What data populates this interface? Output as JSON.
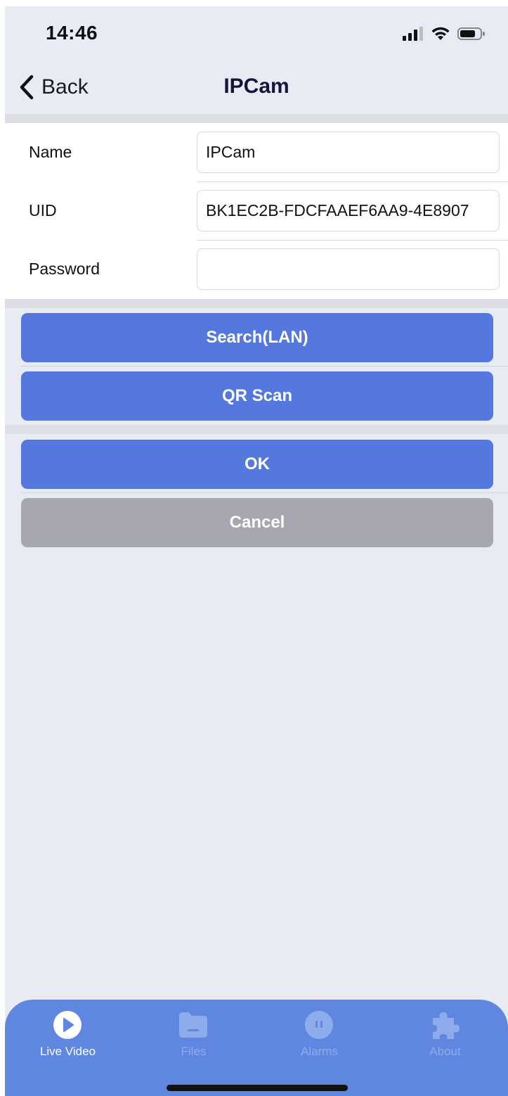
{
  "status_bar": {
    "time": "14:46"
  },
  "nav": {
    "back_label": "Back",
    "title": "IPCam"
  },
  "form": {
    "name_label": "Name",
    "name_value": "IPCam",
    "uid_label": "UID",
    "uid_value": "BK1EC2B-FDCFAAEF6AA9-4E8907",
    "password_label": "Password",
    "password_value": ""
  },
  "buttons": {
    "search_lan": "Search(LAN)",
    "qr_scan": "QR Scan",
    "ok": "OK",
    "cancel": "Cancel"
  },
  "tab_bar": {
    "tabs": [
      {
        "label": "Live Video",
        "icon": "play-icon",
        "active": true
      },
      {
        "label": "Files",
        "icon": "folder-icon",
        "active": false
      },
      {
        "label": "Alarms",
        "icon": "alarm-icon",
        "active": false
      },
      {
        "label": "About",
        "icon": "puzzle-icon",
        "active": false
      }
    ]
  },
  "colors": {
    "button_blue": "#5478de",
    "button_gray": "#a6a7b0",
    "tab_bar": "#6087df",
    "background": "#e9ebf4"
  }
}
